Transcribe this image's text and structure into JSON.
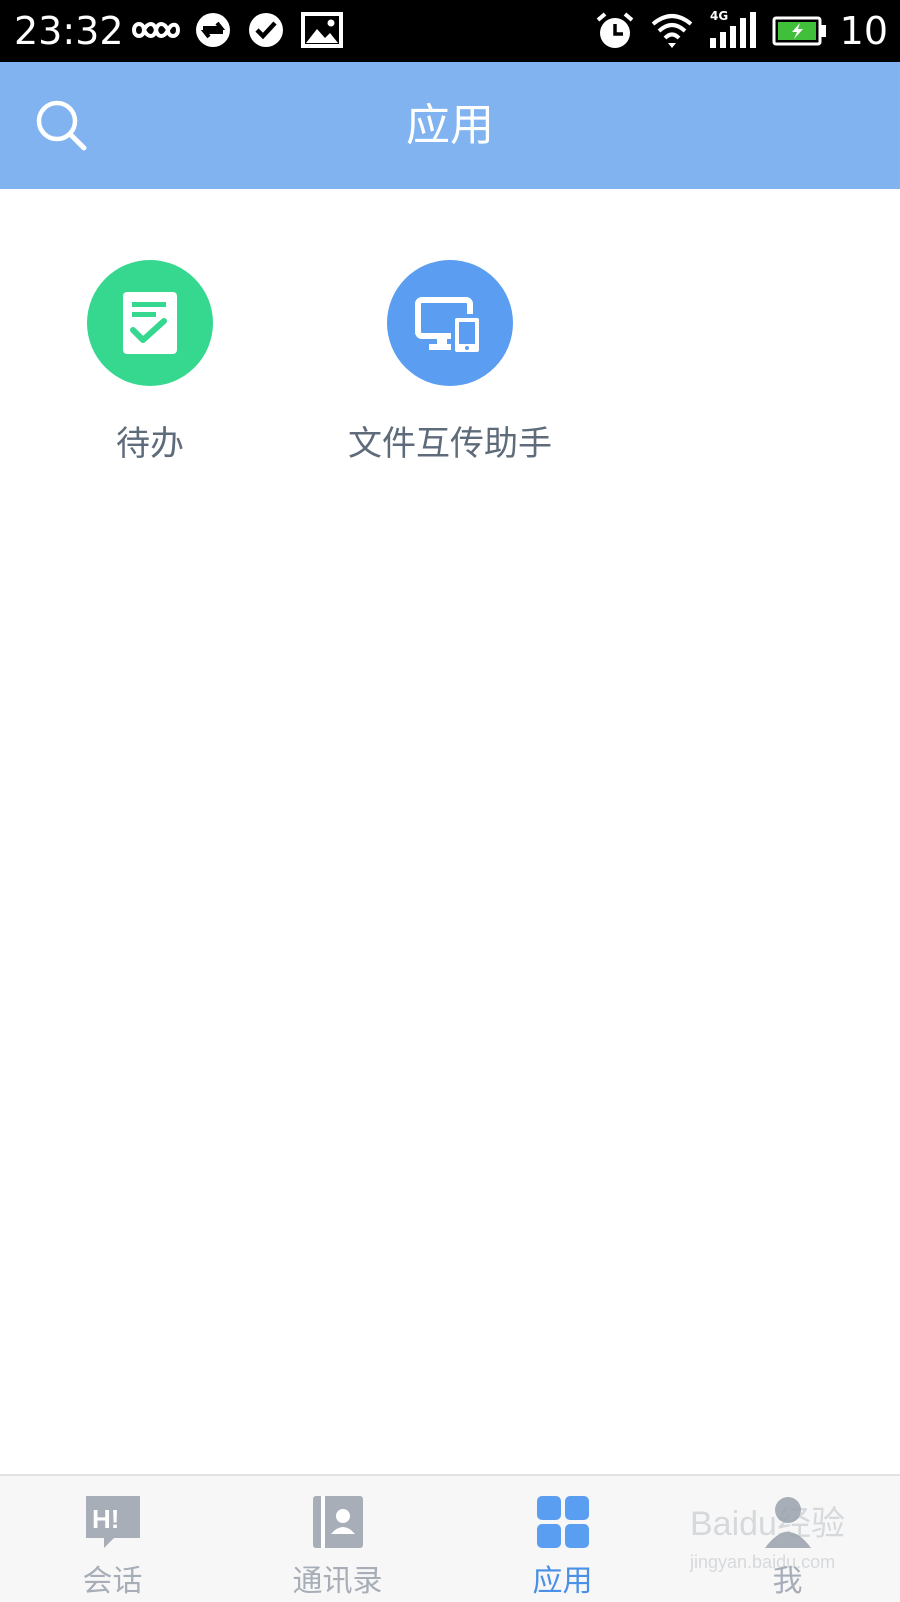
{
  "status_bar": {
    "time": "23:32",
    "battery_percent": "10",
    "network_type": "4G",
    "icons": [
      "infinity-icon",
      "sync-icon",
      "check-circle-icon",
      "image-icon",
      "alarm-icon",
      "wifi-icon",
      "signal-icon",
      "battery-charging-icon"
    ]
  },
  "header": {
    "title": "应用",
    "search_icon": "search-icon"
  },
  "apps": [
    {
      "label": "待办",
      "icon": "todo-icon",
      "color": "#35d88e"
    },
    {
      "label": "文件互传助手",
      "icon": "file-transfer-icon",
      "color": "#5b9df0"
    }
  ],
  "bottom_nav": {
    "items": [
      {
        "label": "会话",
        "icon": "chat-icon",
        "active": false
      },
      {
        "label": "通讯录",
        "icon": "contacts-icon",
        "active": false
      },
      {
        "label": "应用",
        "icon": "apps-grid-icon",
        "active": true
      },
      {
        "label": "我",
        "icon": "profile-icon",
        "active": false
      }
    ],
    "active_color": "#4a90e6",
    "inactive_color": "#a7aeb8"
  },
  "watermark": {
    "line1": "Baidu经验",
    "line2": "jingyan.baidu.com"
  },
  "colors": {
    "header_bg": "#80b3f0",
    "status_bar_bg": "#000000"
  }
}
